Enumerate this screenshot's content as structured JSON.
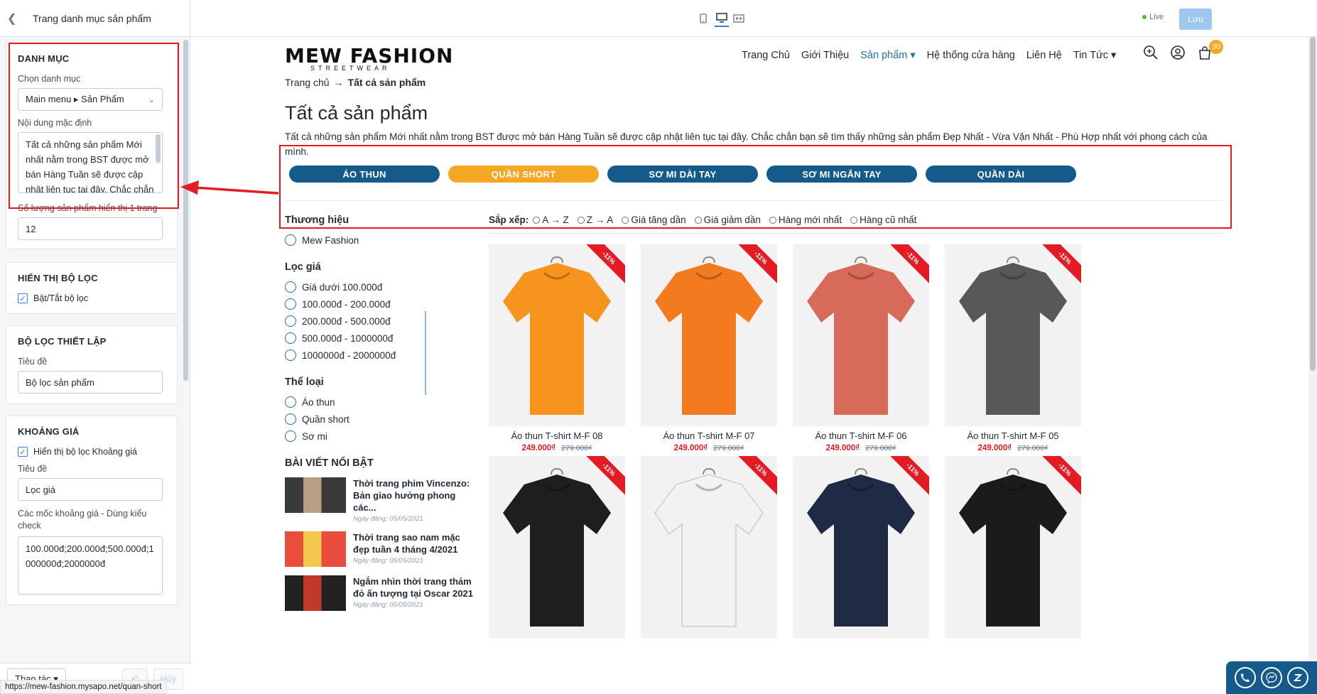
{
  "panel": {
    "title": "Trang danh mục sản phẩm",
    "sections": {
      "category": {
        "title": "DANH MỤC",
        "choose_label": "Chọn danh mục",
        "choose_value": "Main menu ▸ Sản Phẩm",
        "default_content_label": "Nội dung mặc định",
        "default_content": "Tất cả những sản phẩm Mới nhất nằm trong BST được mở bán Hàng Tuần sẽ được cập nhật liên tục tại đây. Chắc chắn bạn sẽ tìm thấy",
        "per_page_label": "Số lượng sản phẩm hiển thị 1 trang",
        "per_page_value": "12"
      },
      "show_filter": {
        "title": "HIỂN THỊ BỘ LỌC",
        "toggle_label": "Bật/Tắt bộ lọc"
      },
      "filter_setup": {
        "title": "BỘ LỌC THIẾT LẬP",
        "heading_label": "Tiêu đề",
        "heading_value": "Bộ lọc sản phẩm"
      },
      "price_range": {
        "title": "KHOẢNG GIÁ",
        "show_label": "Hiển thị bộ lọc Khoảng giá",
        "heading_label": "Tiêu đề",
        "heading_value": "Lọc giá",
        "milestones_label": "Các mốc khoảng giá - Dùng kiểu check",
        "milestones_value": "100.000đ;200.000đ;500.000đ;1000000đ;2000000đ"
      }
    },
    "footer": {
      "actions_label": "Thao tác ▾",
      "redo_label": "Hủy"
    },
    "status_url": "https://mew-fashion.mysapo.net/quan-short"
  },
  "topbar": {
    "live_label": "Live",
    "save_label": "Lưu"
  },
  "store": {
    "logo_main": "MEW FASHION",
    "logo_sub": "STREETWEAR",
    "nav": [
      "Trang Chủ",
      "Giới Thiệu",
      "Sản phẩm ▾",
      "Hệ thống cửa hàng",
      "Liên Hệ",
      "Tin Tức ▾"
    ],
    "cart_count": "30",
    "breadcrumb": {
      "home": "Trang chủ",
      "sep": "→",
      "current": "Tất cả sản phẩm"
    },
    "page_title": "Tất cả sản phẩm",
    "intro": "Tất cả những sản phẩm Mới nhất nằm trong BST được mở bán Hàng Tuần sẽ được cập nhật liên tục tại đây. Chắc chắn bạn sẽ tìm thấy những sản phẩm Đẹp Nhất - Vừa Vặn Nhất - Phù Hợp nhất với phong cách của mình.",
    "categories": [
      {
        "label": "ÁO THUN",
        "color": "#145a8b"
      },
      {
        "label": "QUẦN SHORT",
        "color": "#f5a623"
      },
      {
        "label": "SƠ MI DÀI TAY",
        "color": "#145a8b"
      },
      {
        "label": "SƠ MI NGẮN TAY",
        "color": "#145a8b"
      },
      {
        "label": "QUẦN DÀI",
        "color": "#145a8b"
      }
    ],
    "filters": {
      "brand_title": "Thương hiệu",
      "brands": [
        "Mew Fashion"
      ],
      "price_title": "Lọc giá",
      "prices": [
        "Giá dưới 100.000đ",
        "100.000đ - 200.000đ",
        "200.000đ - 500.000đ",
        "500.000đ - 1000000đ",
        "1000000đ - 2000000đ"
      ],
      "type_title": "Thể loại",
      "types": [
        "Áo thun",
        "Quần short",
        "Sơ mi"
      ]
    },
    "blog": {
      "title": "BÀI VIẾT NỔI BẬT",
      "posts": [
        {
          "title": "Thời trang phim Vincenzo: Bản giao hưởng phong các...",
          "date": "Ngày đăng: 05/05/2021"
        },
        {
          "title": "Thời trang sao nam mặc đẹp tuần 4 tháng 4/2021",
          "date": "Ngày đăng: 05/05/2021"
        },
        {
          "title": "Ngắm nhìn thời trang thảm đỏ ấn tượng tại Oscar 2021",
          "date": "Ngày đăng: 05/05/2021"
        }
      ]
    },
    "sort": {
      "label": "Sắp xếp:",
      "options": [
        "A → Z",
        "Z → A",
        "Giá tăng dần",
        "Giá giảm dần",
        "Hàng mới nhất",
        "Hàng cũ nhất"
      ]
    },
    "products": [
      {
        "name": "Áo thun T-shirt M-F 08",
        "price": "249.000₫",
        "old_price": "279.000₫",
        "discount": "-11%",
        "shirt_color": "#f7941d"
      },
      {
        "name": "Áo thun T-shirt M-F 07",
        "price": "249.000₫",
        "old_price": "279.000₫",
        "discount": "-11%",
        "shirt_color": "#f47a20"
      },
      {
        "name": "Áo thun T-shirt M-F 06",
        "price": "249.000₫",
        "old_price": "279.000₫",
        "discount": "-11%",
        "shirt_color": "#d86a5a"
      },
      {
        "name": "Áo thun T-shirt M-F 05",
        "price": "249.000₫",
        "old_price": "279.000₫",
        "discount": "-11%",
        "shirt_color": "#58585a"
      },
      {
        "name": "",
        "price": "",
        "old_price": "",
        "discount": "-11%",
        "shirt_color": "#1e1e1e"
      },
      {
        "name": "",
        "price": "",
        "old_price": "",
        "discount": "-11%",
        "shirt_color": "#f2f2f2"
      },
      {
        "name": "",
        "price": "",
        "old_price": "",
        "discount": "-11%",
        "shirt_color": "#1f2a44"
      },
      {
        "name": "",
        "price": "",
        "old_price": "",
        "discount": "-11%",
        "shirt_color": "#1b1b1b"
      }
    ]
  }
}
